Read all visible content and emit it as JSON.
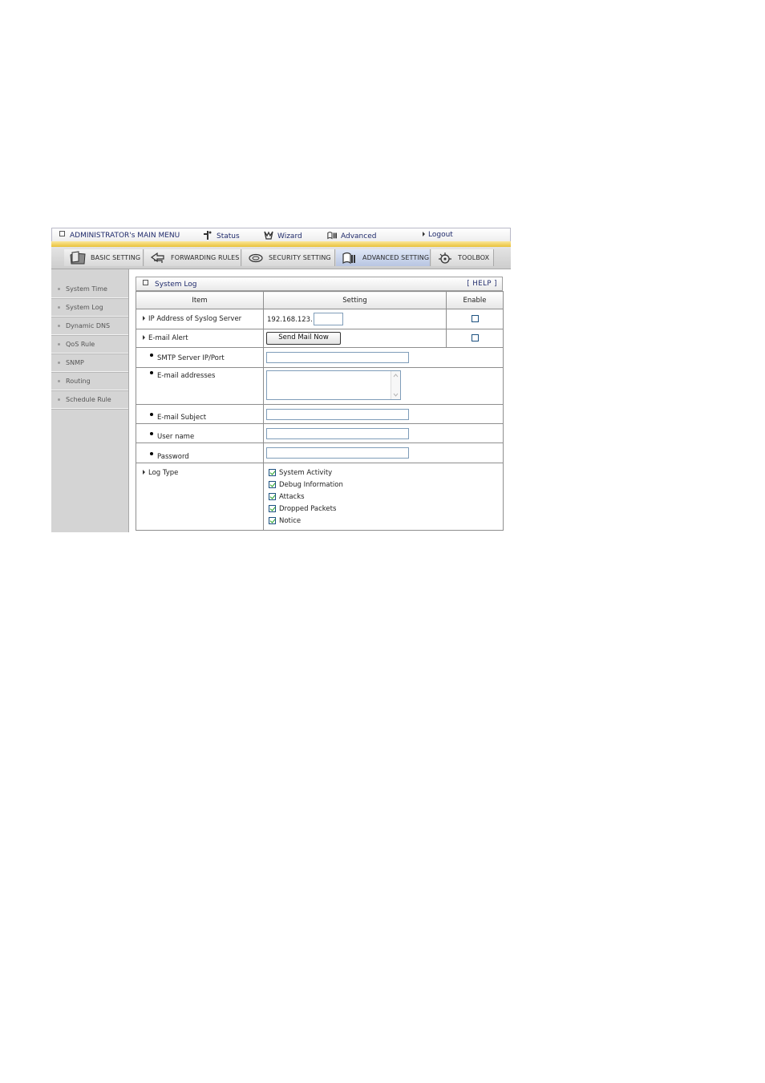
{
  "topbar": {
    "main_menu": "ADMINISTRATOR's MAIN MENU",
    "status": "Status",
    "wizard": "Wizard",
    "advanced": "Advanced",
    "logout": "Logout"
  },
  "tabs": [
    {
      "label": "BASIC SETTING",
      "icon": "folder-icon"
    },
    {
      "label": "FORWARDING RULES",
      "icon": "forward-arrows-icon"
    },
    {
      "label": "SECURITY SETTING",
      "icon": "security-icon"
    },
    {
      "label": "ADVANCED SETTING",
      "icon": "advanced-folder-icon"
    },
    {
      "label": "TOOLBOX",
      "icon": "toolbox-icon"
    }
  ],
  "active_tab": "ADVANCED SETTING",
  "sidebar": {
    "items": [
      {
        "label": "System Time"
      },
      {
        "label": "System Log"
      },
      {
        "label": "Dynamic DNS"
      },
      {
        "label": "QoS Rule"
      },
      {
        "label": "SNMP"
      },
      {
        "label": "Routing"
      },
      {
        "label": "Schedule Rule"
      }
    ]
  },
  "panel": {
    "title": "System Log",
    "help": "[ HELP ]"
  },
  "table": {
    "headers": {
      "item": "Item",
      "setting": "Setting",
      "enable": "Enable"
    },
    "syslog": {
      "label": "IP Address of Syslog Server",
      "ip_prefix": "192.168.123.",
      "ip_value": "",
      "enabled": false
    },
    "email_alert": {
      "label": "E-mail Alert",
      "button": "Send Mail Now",
      "enabled": false
    },
    "smtp": {
      "label": "SMTP Server IP/Port",
      "value": ""
    },
    "email_addresses": {
      "label": "E-mail addresses",
      "value": ""
    },
    "email_subject": {
      "label": "E-mail Subject",
      "value": ""
    },
    "username": {
      "label": "User name",
      "value": ""
    },
    "password": {
      "label": "Password",
      "value": ""
    },
    "log_type": {
      "label": "Log Type",
      "options": [
        {
          "label": "System Activity",
          "checked": true
        },
        {
          "label": "Debug Information",
          "checked": true
        },
        {
          "label": "Attacks",
          "checked": true
        },
        {
          "label": "Dropped Packets",
          "checked": true
        },
        {
          "label": "Notice",
          "checked": true
        }
      ]
    }
  }
}
